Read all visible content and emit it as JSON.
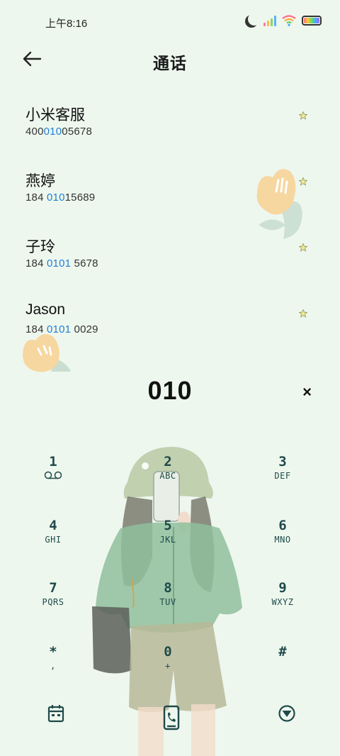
{
  "status": {
    "time": "上午8:16"
  },
  "header": {
    "title": "通话"
  },
  "contacts": [
    {
      "name": "小米客服",
      "num_pre": "400",
      "num_hl": "010",
      "num_post": "05678"
    },
    {
      "name": "燕婷",
      "num_pre": "184 ",
      "num_hl": "010",
      "num_post": "15689"
    },
    {
      "name": "子玲",
      "num_pre": "184 ",
      "num_hl": "0101",
      "num_post": " 5678"
    },
    {
      "name": "Jason",
      "num_pre": "184 ",
      "num_hl": "0101",
      "num_post": " 0029"
    }
  ],
  "dialer": {
    "number": "010",
    "clear_symbol": "×"
  },
  "keypad": [
    {
      "digit": "1",
      "letters": ""
    },
    {
      "digit": "2",
      "letters": "ABC"
    },
    {
      "digit": "3",
      "letters": "DEF"
    },
    {
      "digit": "4",
      "letters": "GHI"
    },
    {
      "digit": "5",
      "letters": "JKL"
    },
    {
      "digit": "6",
      "letters": "MNO"
    },
    {
      "digit": "7",
      "letters": "PQRS"
    },
    {
      "digit": "8",
      "letters": "TUV"
    },
    {
      "digit": "9",
      "letters": "WXYZ"
    },
    {
      "digit": "*",
      "letters": ","
    },
    {
      "digit": "0",
      "letters": "+"
    },
    {
      "digit": "#",
      "letters": ""
    }
  ],
  "colors": {
    "background": "#eef7ee",
    "highlight": "#1e7fd6",
    "key_color": "#1f4a4a"
  },
  "icons": {
    "back": "arrow-left-icon",
    "voicemail": "voicemail-icon",
    "calendar": "calendar-icon",
    "dial": "phone-dial-icon",
    "more": "triangle-down-icon",
    "star": "star-icon"
  }
}
